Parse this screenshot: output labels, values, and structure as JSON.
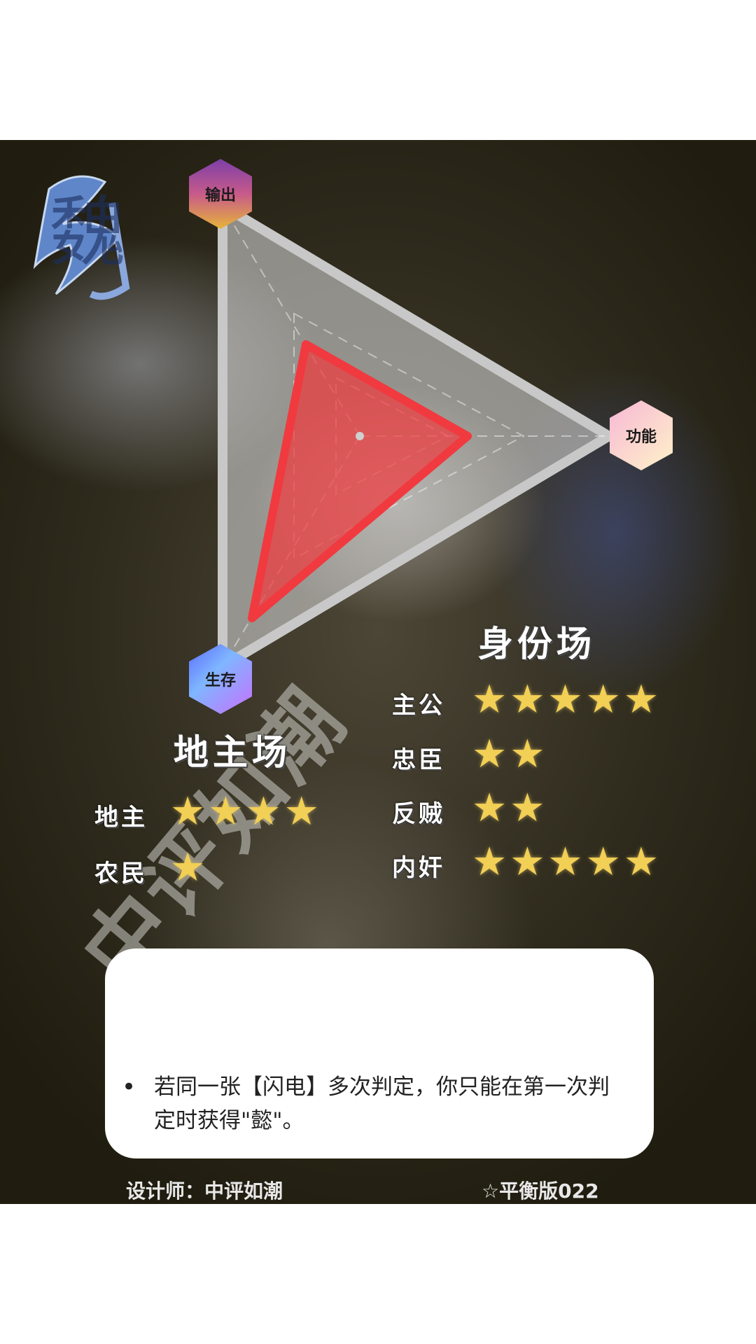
{
  "logo_text": "魏",
  "radar": {
    "axes": [
      "输出",
      "功能",
      "生存"
    ],
    "colors": {
      "frame": "#c8c8c8",
      "fill": "#f03a3f"
    }
  },
  "landlord": {
    "title": "地主场",
    "roles": [
      {
        "label": "地主",
        "stars": "★★★★",
        "rating": 4
      },
      {
        "label": "农民",
        "stars": "★",
        "rating": 1
      }
    ]
  },
  "identity": {
    "title": "身份场",
    "roles": [
      {
        "label": "主公",
        "stars": "★★★★★",
        "rating": 5
      },
      {
        "label": "忠臣",
        "stars": "★★",
        "rating": 2
      },
      {
        "label": "反贼",
        "stars": "★★",
        "rating": 2
      },
      {
        "label": "内奸",
        "stars": "★★★★★",
        "rating": 5
      }
    ]
  },
  "watermark": "中评如潮",
  "skill_note": "若同一张【闪电】多次判定，你只能在第一次判定时获得\"懿\"。",
  "bullet": "•",
  "footer": {
    "designer": "设计师：中评如潮",
    "version": "☆平衡版022"
  }
}
